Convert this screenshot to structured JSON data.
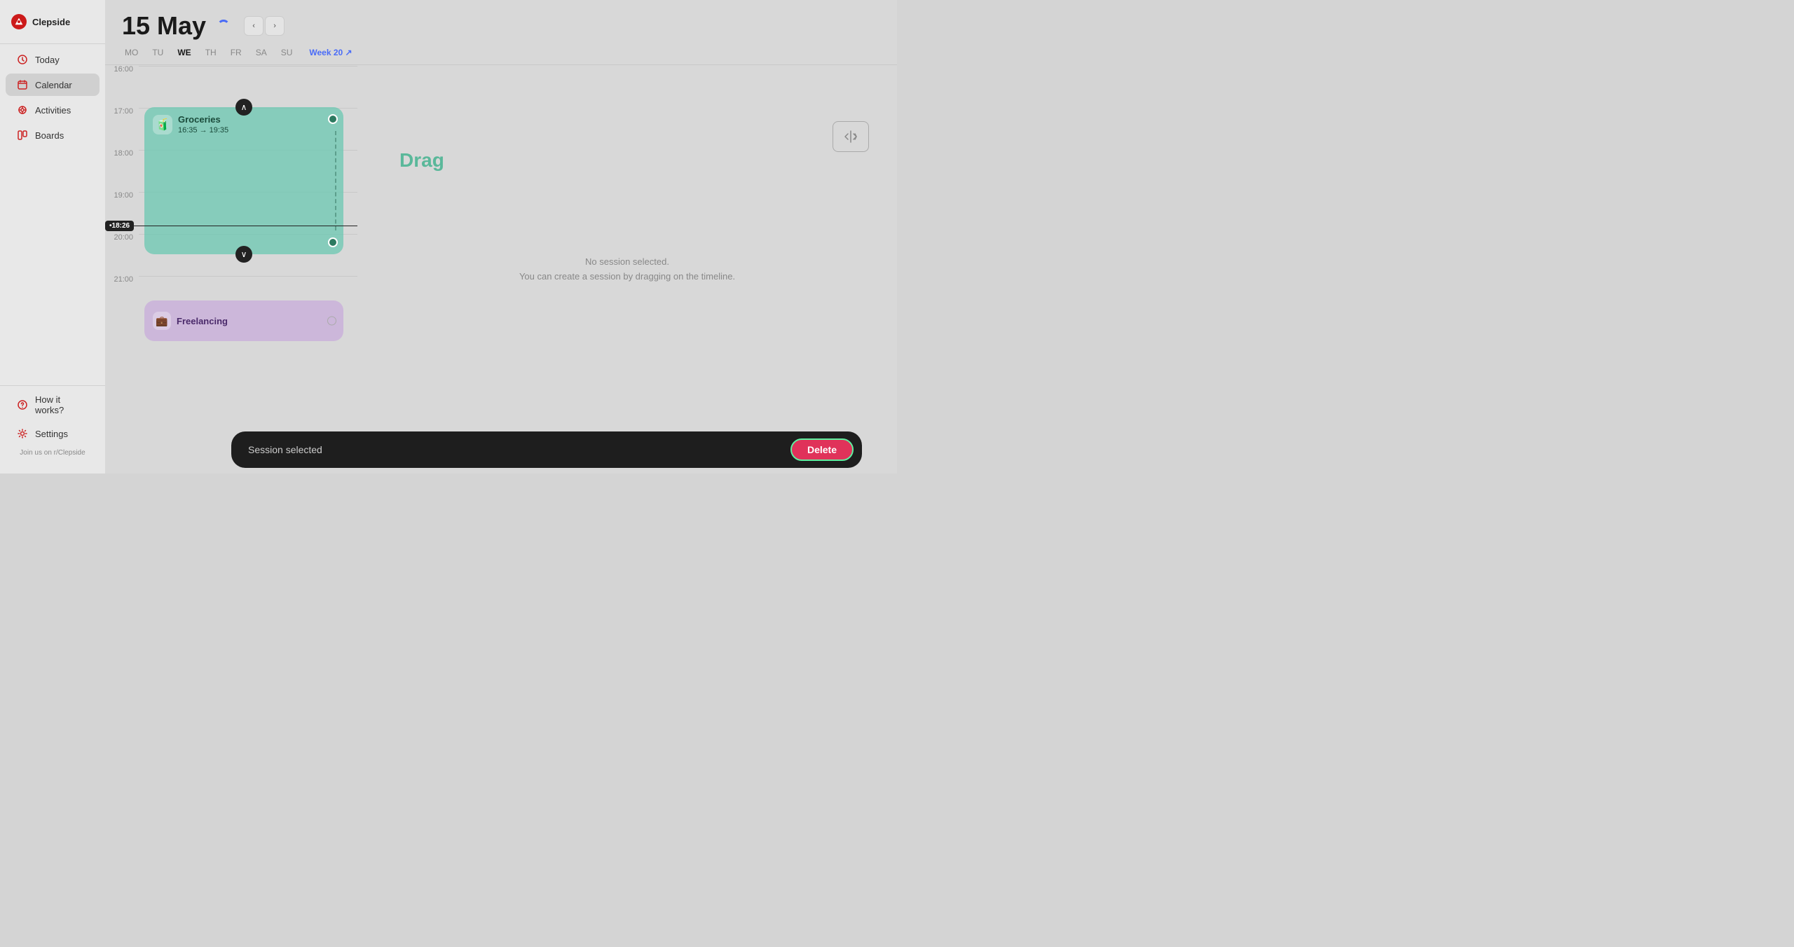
{
  "app": {
    "name": "Clepside"
  },
  "sidebar": {
    "items": [
      {
        "id": "today",
        "label": "Today",
        "icon": "clock-icon",
        "active": false
      },
      {
        "id": "calendar",
        "label": "Calendar",
        "icon": "calendar-icon",
        "active": true
      },
      {
        "id": "activities",
        "label": "Activities",
        "icon": "activities-icon",
        "active": false
      },
      {
        "id": "boards",
        "label": "Boards",
        "icon": "boards-icon",
        "active": false
      }
    ],
    "bottom_items": [
      {
        "id": "how-it-works",
        "label": "How it works?",
        "icon": "question-icon"
      },
      {
        "id": "settings",
        "label": "Settings",
        "icon": "gear-icon"
      }
    ],
    "join_text": "Join us on r/Clepside"
  },
  "header": {
    "date": "15 May",
    "days": [
      {
        "id": "mo",
        "label": "MO",
        "active": false
      },
      {
        "id": "tu",
        "label": "TU",
        "active": false
      },
      {
        "id": "we",
        "label": "WE",
        "active": true
      },
      {
        "id": "th",
        "label": "TH",
        "active": false
      },
      {
        "id": "fr",
        "label": "FR",
        "active": false
      },
      {
        "id": "sa",
        "label": "SA",
        "active": false
      },
      {
        "id": "su",
        "label": "SU",
        "active": false
      }
    ],
    "week_label": "Week 20 ↗"
  },
  "timeline": {
    "times": [
      "16:00",
      "17:00",
      "18:00",
      "19:00",
      "20:00",
      "21:00"
    ],
    "current_time": "•18:26"
  },
  "sessions": [
    {
      "id": "groceries",
      "title": "Groceries",
      "time_range": "16:35 → 19:35",
      "emoji": "🧃",
      "color": "teal"
    },
    {
      "id": "freelancing",
      "title": "Freelancing",
      "emoji": "💼",
      "color": "purple"
    }
  ],
  "right_panel": {
    "drag_label": "Drag",
    "no_session_line1": "No session selected.",
    "no_session_line2": "You can create a session by dragging on the timeline."
  },
  "bottom_bar": {
    "text": "Session selected",
    "delete_label": "Delete"
  }
}
